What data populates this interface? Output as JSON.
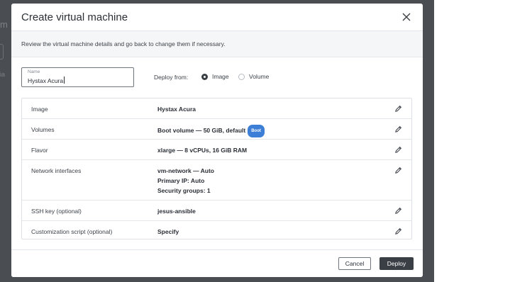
{
  "background": {
    "fragments": [
      "m",
      "ia"
    ]
  },
  "modal": {
    "title": "Create virtual machine",
    "subtitle": "Review the virtual machine details and go back to change them if necessary."
  },
  "name_field": {
    "label": "Name",
    "value": "Hystax Acura"
  },
  "deploy_from": {
    "label": "Deploy from:",
    "options": [
      {
        "label": "Image",
        "selected": true
      },
      {
        "label": "Volume",
        "selected": false
      }
    ]
  },
  "details": [
    {
      "label": "Image",
      "lines": [
        "Hystax Acura"
      ]
    },
    {
      "label": "Volumes",
      "lines": [
        "Boot volume  — 50 GiB, default"
      ],
      "badge": "Boot"
    },
    {
      "label": "Flavor",
      "lines": [
        "xlarge  — 8 vCPUs, 16 GiB RAM"
      ]
    },
    {
      "label": "Network interfaces",
      "lines": [
        "vm-network  — Auto",
        "Primary IP:  Auto",
        "Security groups:  1"
      ]
    },
    {
      "label": "SSH key (optional)",
      "lines": [
        "jesus-ansible"
      ]
    },
    {
      "label": "Customization script (optional)",
      "lines": [
        "Specify"
      ]
    }
  ],
  "footer": {
    "cancel_label": "Cancel",
    "deploy_label": "Deploy"
  },
  "colors": {
    "badge": "#3d7ed6",
    "primary_button": "#3a3f46"
  }
}
